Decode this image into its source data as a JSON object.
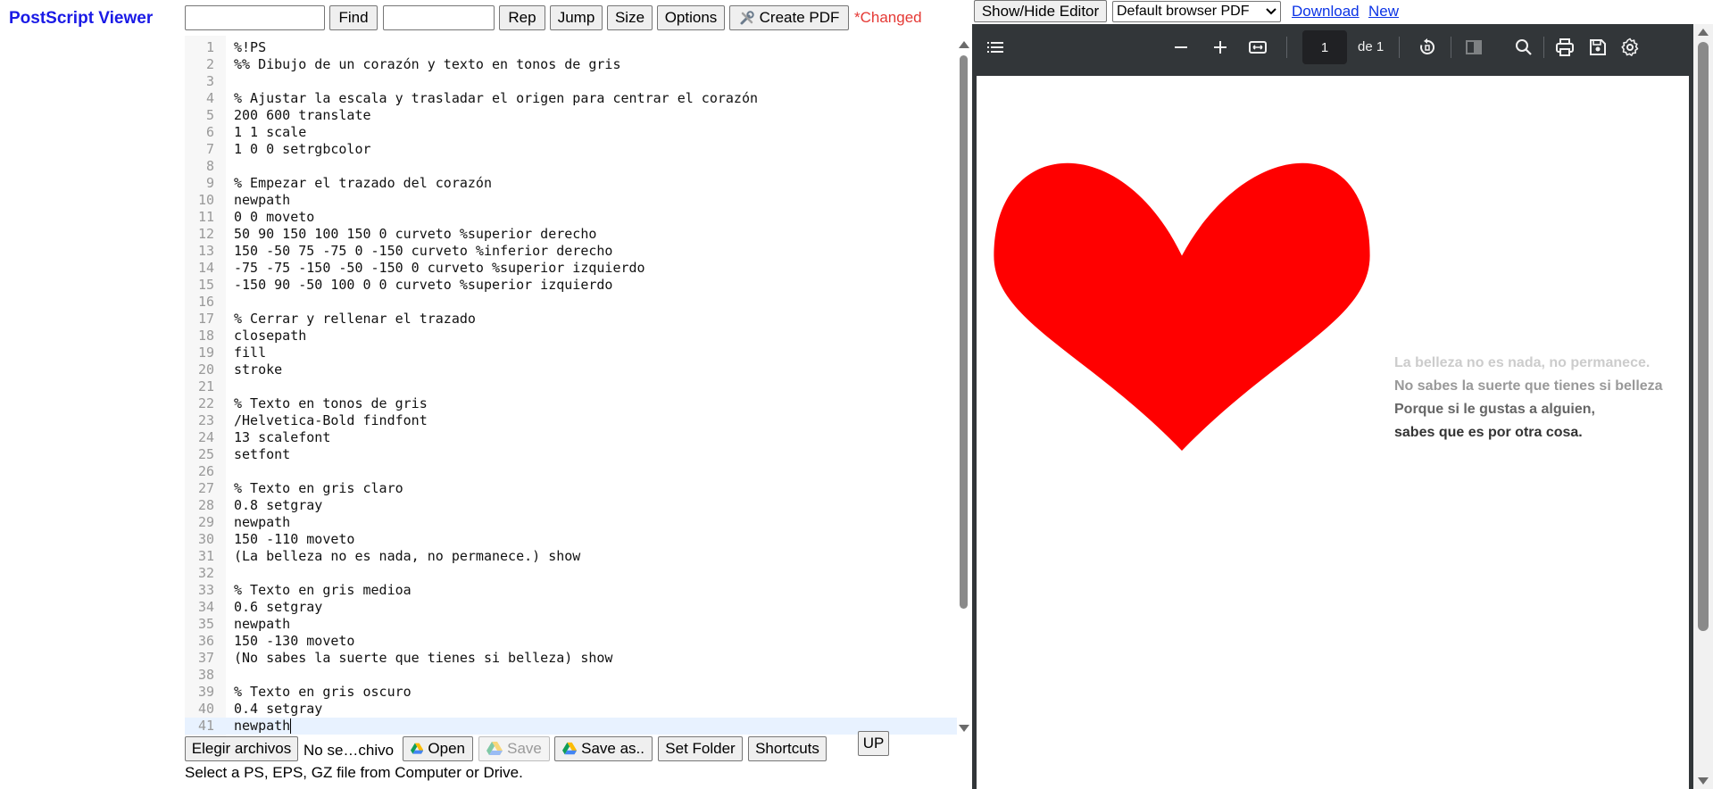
{
  "app": {
    "title": "PostScript Viewer",
    "changed_label": "*Changed"
  },
  "toolbar": {
    "find_input_value": "",
    "find_label": "Find",
    "replace_input_value": "",
    "replace_label": "Rep",
    "jump_label": "Jump",
    "size_label": "Size",
    "options_label": "Options",
    "create_pdf_label": "Create PDF",
    "show_hide_label": "Show/Hide Editor",
    "pdf_mode_selected": "Default browser PDF",
    "download_label": "Download",
    "new_label": "New"
  },
  "editor": {
    "lines": [
      "%!PS",
      "%% Dibujo de un corazón y texto en tonos de gris",
      "",
      "% Ajustar la escala y trasladar el origen para centrar el corazón",
      "200 600 translate",
      "1 1 scale",
      "1 0 0 setrgbcolor",
      "",
      "% Empezar el trazado del corazón",
      "newpath",
      "0 0 moveto",
      "50 90 150 100 150 0 curveto %superior derecho",
      "150 -50 75 -75 0 -150 curveto %inferior derecho",
      "-75 -75 -150 -50 -150 0 curveto %superior izquierdo",
      "-150 90 -50 100 0 0 curveto %superior izquierdo",
      "",
      "% Cerrar y rellenar el trazado",
      "closepath",
      "fill",
      "stroke",
      "",
      "% Texto en tonos de gris",
      "/Helvetica-Bold findfont",
      "13 scalefont",
      "setfont",
      "",
      "% Texto en gris claro",
      "0.8 setgray",
      "newpath",
      "150 -110 moveto",
      "(La belleza no es nada, no permanece.) show",
      "",
      "% Texto en gris medioa",
      "0.6 setgray",
      "newpath",
      "150 -130 moveto",
      "(No sabes la suerte que tienes si belleza) show",
      "",
      "% Texto en gris oscuro",
      "0.4 setgray",
      "newpath"
    ],
    "active_line": 41
  },
  "filebar": {
    "choose_files_label": "Elegir archivos",
    "file_status": "No se…chivo",
    "open_label": "Open",
    "save_label": "Save",
    "save_as_label": "Save as..",
    "set_folder_label": "Set Folder",
    "shortcuts_label": "Shortcuts",
    "up_label": "UP",
    "hint": "Select a PS, EPS, GZ file from Computer or Drive."
  },
  "viewer": {
    "page_number": "1",
    "page_of": "de 1",
    "heart_color": "#ff0000",
    "text_lines": [
      {
        "text": "La belleza no es nada, no permanece.",
        "color": "#cccccc"
      },
      {
        "text": "No sabes la suerte que tienes si belleza",
        "color": "#999999"
      },
      {
        "text": "Porque si le gustas a alguien,",
        "color": "#666666"
      },
      {
        "text": "sabes que es por otra cosa.",
        "color": "#333333"
      }
    ]
  }
}
